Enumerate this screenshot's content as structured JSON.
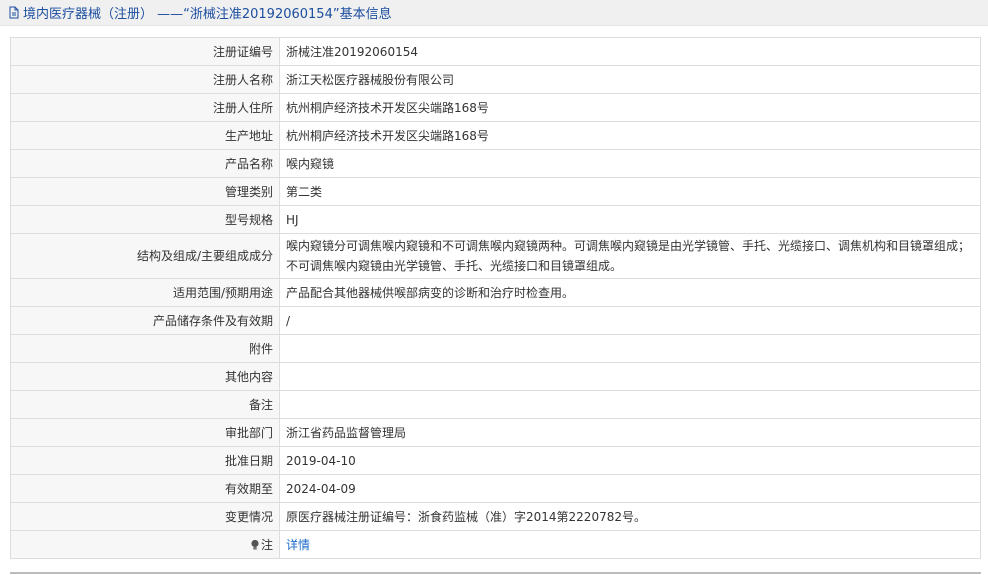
{
  "header": {
    "icon": "document-icon",
    "title": "境内医疗器械（注册） ——“浙械注准20192060154”基本信息"
  },
  "rows": [
    {
      "label": "注册证编号",
      "value": "浙械注准20192060154"
    },
    {
      "label": "注册人名称",
      "value": "浙江天松医疗器械股份有限公司"
    },
    {
      "label": "注册人住所",
      "value": "杭州桐庐经济技术开发区尖端路168号"
    },
    {
      "label": "生产地址",
      "value": "杭州桐庐经济技术开发区尖端路168号"
    },
    {
      "label": "产品名称",
      "value": "喉内窥镜"
    },
    {
      "label": "管理类别",
      "value": "第二类"
    },
    {
      "label": "型号规格",
      "value": "HJ"
    },
    {
      "label": "结构及组成/主要组成成分",
      "value": "喉内窥镜分可调焦喉内窥镜和不可调焦喉内窥镜两种。可调焦喉内窥镜是由光学镜管、手托、光缆接口、调焦机构和目镜罩组成；不可调焦喉内窥镜由光学镜管、手托、光缆接口和目镜罩组成。"
    },
    {
      "label": "适用范围/预期用途",
      "value": "产品配合其他器械供喉部病变的诊断和治疗时检查用。"
    },
    {
      "label": "产品储存条件及有效期",
      "value": "/"
    },
    {
      "label": "附件",
      "value": ""
    },
    {
      "label": "其他内容",
      "value": ""
    },
    {
      "label": "备注",
      "value": ""
    },
    {
      "label": "审批部门",
      "value": "浙江省药品监督管理局"
    },
    {
      "label": "批准日期",
      "value": "2019-04-10"
    },
    {
      "label": "有效期至",
      "value": "2024-04-09"
    },
    {
      "label": "变更情况",
      "value": "原医疗器械注册证编号：浙食药监械（准）字2014第2220782号。"
    },
    {
      "label": "注",
      "value": "详情",
      "icon": "lightbulb-icon"
    }
  ],
  "colors": {
    "header_text": "#1c4ea0",
    "link": "#1c6ac9",
    "label_bg": "#f7f7f7",
    "border": "#dddddd"
  }
}
